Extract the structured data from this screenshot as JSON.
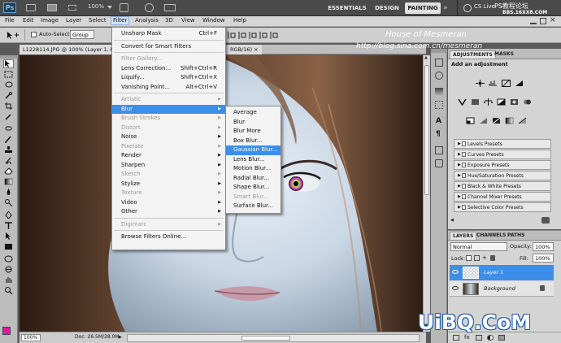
{
  "app": {
    "logo": "Ps",
    "zoom": "100%",
    "workspaces": [
      "ESSENTIALS",
      "DESIGN",
      "PAINTING"
    ],
    "active_workspace": "PAINTING",
    "cs_live": "CS Live"
  },
  "watermark": {
    "title": "House of Mesmeran",
    "url": "http://blog.sina.com.cn/mesmeran",
    "site_top": "PS教程论坛",
    "site_sub": "BBS.16XX8.COM",
    "logo_bottom": "UiBQ.CoM"
  },
  "menubar": {
    "items": [
      "File",
      "Edit",
      "Image",
      "Layer",
      "Select",
      "Filter",
      "Analysis",
      "3D",
      "View",
      "Window",
      "Help"
    ],
    "active": "Filter"
  },
  "options": {
    "auto_select_label": "Auto-Select:",
    "auto_select_value": "Group"
  },
  "document": {
    "tab_title": "L1228114.JPG @ 100% (Layer 1, R",
    "tab_suffix": "RGB/16) ×",
    "zoom": "100%",
    "doc_info": "Doc: 26.5M/28.0M"
  },
  "filter_menu": {
    "sections": [
      [
        {
          "label": "Unsharp Mask",
          "shortcut": "Ctrl+F"
        }
      ],
      [
        {
          "label": "Convert for Smart Filters"
        }
      ],
      [
        {
          "label": "Filter Gallery...",
          "disabled": true
        },
        {
          "label": "Lens Correction...",
          "shortcut": "Shift+Ctrl+R"
        },
        {
          "label": "Liquify...",
          "shortcut": "Shift+Ctrl+X"
        },
        {
          "label": "Vanishing Point...",
          "shortcut": "Alt+Ctrl+V"
        }
      ],
      [
        {
          "label": "Artistic",
          "submenu": true,
          "disabled": true
        },
        {
          "label": "Blur",
          "submenu": true,
          "highlighted": true
        },
        {
          "label": "Brush Strokes",
          "submenu": true,
          "disabled": true
        },
        {
          "label": "Distort",
          "submenu": true,
          "disabled": true
        },
        {
          "label": "Noise",
          "submenu": true
        },
        {
          "label": "Pixelate",
          "submenu": true,
          "disabled": true
        },
        {
          "label": "Render",
          "submenu": true
        },
        {
          "label": "Sharpen",
          "submenu": true
        },
        {
          "label": "Sketch",
          "submenu": true,
          "disabled": true
        },
        {
          "label": "Stylize",
          "submenu": true
        },
        {
          "label": "Texture",
          "submenu": true,
          "disabled": true
        },
        {
          "label": "Video",
          "submenu": true
        },
        {
          "label": "Other",
          "submenu": true
        }
      ],
      [
        {
          "label": "Digimarc",
          "submenu": true,
          "disabled": true
        }
      ],
      [
        {
          "label": "Browse Filters Online..."
        }
      ]
    ]
  },
  "blur_submenu": {
    "items": [
      {
        "label": "Average"
      },
      {
        "label": "Blur"
      },
      {
        "label": "Blur More"
      },
      {
        "label": "Box Blur..."
      },
      {
        "label": "Gaussian Blur...",
        "highlighted": true
      },
      {
        "label": "Lens Blur..."
      },
      {
        "label": "Motion Blur..."
      },
      {
        "label": "Radial Blur..."
      },
      {
        "label": "Shape Blur..."
      },
      {
        "label": "Smart Blur...",
        "disabled": true
      },
      {
        "label": "Surface Blur..."
      }
    ]
  },
  "adjustments_panel": {
    "tabs": [
      "ADJUSTMENTS",
      "MASKS"
    ],
    "heading": "Add an adjustment",
    "presets": [
      "Levels Presets",
      "Curves Presets",
      "Exposure Presets",
      "Hue/Saturation Presets",
      "Black & White Presets",
      "Channel Mixer Presets",
      "Selective Color Presets"
    ]
  },
  "layers_panel": {
    "tabs": [
      "LAYERS",
      "CHANNELS",
      "PATHS"
    ],
    "blend_mode": "Normal",
    "opacity_label": "Opacity:",
    "opacity": "100%",
    "lock_label": "Lock:",
    "fill_label": "Fill:",
    "fill": "100%",
    "layers": [
      {
        "name": "Layer 1",
        "selected": true
      },
      {
        "name": "Background",
        "selected": false
      }
    ]
  },
  "colors": {
    "foreground": "#e8149c",
    "background": "#000000",
    "menu_highlight": "#3d8ee6"
  }
}
